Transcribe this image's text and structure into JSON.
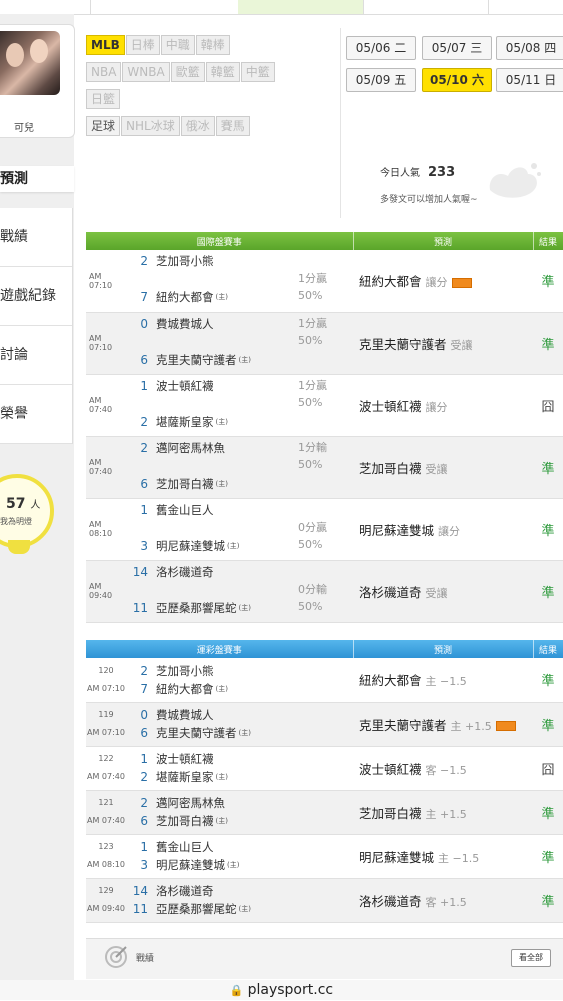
{
  "user": {
    "name": "可兒"
  },
  "left_menu": {
    "section_title": "預測",
    "items": [
      "戰績",
      "遊戲紀錄",
      "討論",
      "榮譽"
    ],
    "popularity_num": "57",
    "popularity_unit": "人",
    "popularity_sub": "我為明燈"
  },
  "sports": [
    {
      "label": "MLB",
      "state": "on"
    },
    {
      "label": "日棒",
      "state": "off"
    },
    {
      "label": "中職",
      "state": "off"
    },
    {
      "label": "韓棒",
      "state": "off"
    },
    {
      "label": "NBA",
      "state": "off"
    },
    {
      "label": "WNBA",
      "state": "off"
    },
    {
      "label": "歐籃",
      "state": "off"
    },
    {
      "label": "韓籃",
      "state": "off"
    },
    {
      "label": "中籃",
      "state": "off"
    },
    {
      "label": "日籃",
      "state": "off"
    },
    {
      "label": "足球",
      "state": "dark"
    },
    {
      "label": "NHL冰球",
      "state": "off"
    },
    {
      "label": "俄冰",
      "state": "off"
    },
    {
      "label": "賽馬",
      "state": "off"
    }
  ],
  "dates": [
    {
      "label": "05/06 二",
      "active": false
    },
    {
      "label": "05/07 三",
      "active": false
    },
    {
      "label": "05/08 四",
      "active": false
    },
    {
      "label": "05/09 五",
      "active": false
    },
    {
      "label": "05/10 六",
      "active": true
    },
    {
      "label": "05/11 日",
      "active": false
    }
  ],
  "popularity": {
    "label": "今日人氣",
    "value": "233",
    "hint": "多發文可以增加人氣喔~"
  },
  "intl": {
    "headers": [
      "國際盤賽事",
      "預測",
      "結果"
    ],
    "games": [
      {
        "time": "AM 07:10",
        "away_score": "2",
        "away": "芝加哥小熊",
        "home_score": "7",
        "home": "紐約大都會",
        "home_tag": "(主)",
        "handicap": "1分贏",
        "pct": "50%",
        "hand_on": "home",
        "pick": "紐約大都會",
        "pick_type": "讓分",
        "badge": true,
        "result": "準"
      },
      {
        "time": "AM 07:10",
        "away_score": "0",
        "away": "費城費城人",
        "home_score": "6",
        "home": "克里夫蘭守護者",
        "home_tag": "(主)",
        "handicap": "1分贏",
        "pct": "50%",
        "hand_on": "away",
        "pick": "克里夫蘭守護者",
        "pick_type": "受讓",
        "badge": false,
        "result": "準"
      },
      {
        "time": "AM 07:40",
        "away_score": "1",
        "away": "波士頓紅襪",
        "home_score": "2",
        "home": "堪薩斯皇家",
        "home_tag": "(主)",
        "handicap": "1分贏",
        "pct": "50%",
        "hand_on": "away",
        "pick": "波士頓紅襪",
        "pick_type": "讓分",
        "badge": false,
        "result": "囧"
      },
      {
        "time": "AM 07:40",
        "away_score": "2",
        "away": "邁阿密馬林魚",
        "home_score": "6",
        "home": "芝加哥白襪",
        "home_tag": "(主)",
        "handicap": "1分輸",
        "pct": "50%",
        "hand_on": "away",
        "pick": "芝加哥白襪",
        "pick_type": "受讓",
        "badge": false,
        "result": "準"
      },
      {
        "time": "AM 08:10",
        "away_score": "1",
        "away": "舊金山巨人",
        "home_score": "3",
        "home": "明尼蘇達雙城",
        "home_tag": "(主)",
        "handicap": "0分贏",
        "pct": "50%",
        "hand_on": "home",
        "pick": "明尼蘇達雙城",
        "pick_type": "讓分",
        "badge": false,
        "result": "準"
      },
      {
        "time": "AM 09:40",
        "away_score": "14",
        "away": "洛杉磯道奇",
        "home_score": "11",
        "home": "亞歷桑那響尾蛇",
        "home_tag": "(主)",
        "handicap": "0分輸",
        "pct": "50%",
        "hand_on": "home",
        "pick": "洛杉磯道奇",
        "pick_type": "受讓",
        "badge": false,
        "result": "準"
      }
    ]
  },
  "lottery": {
    "headers": [
      "運彩盤賽事",
      "預測",
      "結果"
    ],
    "games": [
      {
        "no": "120",
        "time": "AM 07:10",
        "away_score": "2",
        "away": "芝加哥小熊",
        "home_score": "7",
        "home": "紐約大都會",
        "home_tag": "(主)",
        "pick": "紐約大都會",
        "pick_type": "主 −1.5",
        "badge": false,
        "result": "準"
      },
      {
        "no": "119",
        "time": "AM 07:10",
        "away_score": "0",
        "away": "費城費城人",
        "home_score": "6",
        "home": "克里夫蘭守護者",
        "home_tag": "(主)",
        "pick": "克里夫蘭守護者",
        "pick_type": "主 +1.5",
        "badge": true,
        "result": "準"
      },
      {
        "no": "122",
        "time": "AM 07:40",
        "away_score": "1",
        "away": "波士頓紅襪",
        "home_score": "2",
        "home": "堪薩斯皇家",
        "home_tag": "(主)",
        "pick": "波士頓紅襪",
        "pick_type": "客 −1.5",
        "badge": false,
        "result": "囧"
      },
      {
        "no": "121",
        "time": "AM 07:40",
        "away_score": "2",
        "away": "邁阿密馬林魚",
        "home_score": "6",
        "home": "芝加哥白襪",
        "home_tag": "(主)",
        "pick": "芝加哥白襪",
        "pick_type": "主 +1.5",
        "badge": false,
        "result": "準"
      },
      {
        "no": "123",
        "time": "AM 08:10",
        "away_score": "1",
        "away": "舊金山巨人",
        "home_score": "3",
        "home": "明尼蘇達雙城",
        "home_tag": "(主)",
        "pick": "明尼蘇達雙城",
        "pick_type": "主 −1.5",
        "badge": false,
        "result": "準"
      },
      {
        "no": "129",
        "time": "AM 09:40",
        "away_score": "14",
        "away": "洛杉磯道奇",
        "home_score": "11",
        "home": "亞歷桑那響尾蛇",
        "home_tag": "(主)",
        "pick": "洛杉磯道奇",
        "pick_type": "客 +1.5",
        "badge": false,
        "result": "準"
      }
    ]
  },
  "footer": {
    "record_label": "戰績",
    "view_all": "看全部"
  },
  "browser": {
    "url": "playsport.cc"
  }
}
